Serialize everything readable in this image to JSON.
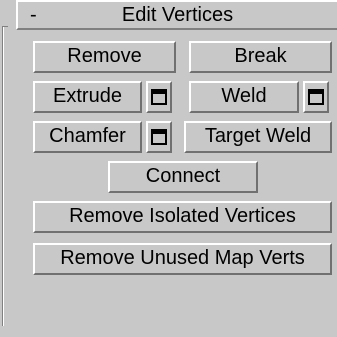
{
  "rollout": {
    "collapse_symbol": "-",
    "title": "Edit Vertices"
  },
  "buttons": {
    "remove": "Remove",
    "break": "Break",
    "extrude": "Extrude",
    "weld": "Weld",
    "chamfer": "Chamfer",
    "target_weld": "Target Weld",
    "connect": "Connect",
    "remove_isolated_vertices": "Remove Isolated Vertices",
    "remove_unused_map_verts": "Remove Unused Map Verts"
  },
  "icons": {
    "settings": "settings-icon"
  },
  "colors": {
    "panel_bg": "#c8c8c8",
    "highlight": "#ffffff",
    "shadow": "#707070"
  }
}
